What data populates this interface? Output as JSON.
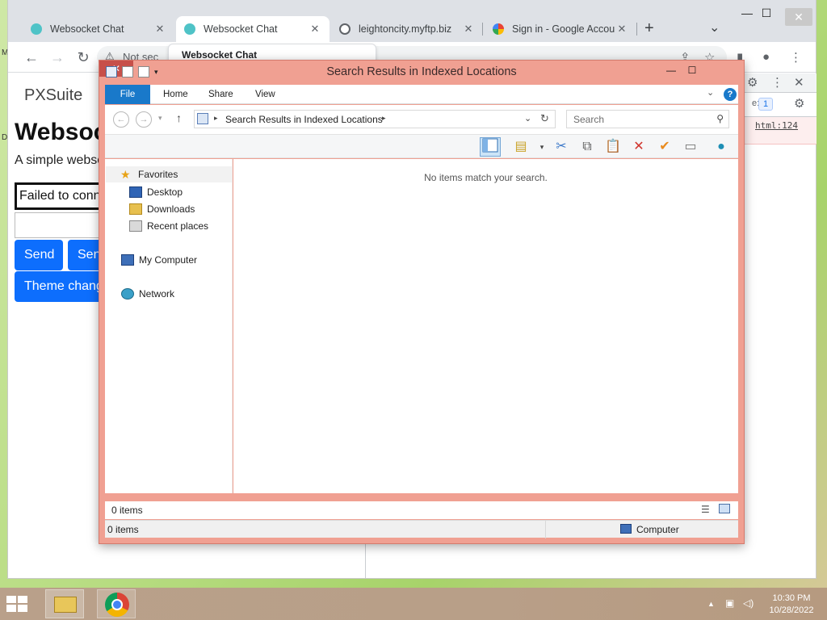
{
  "desktop": {
    "left_label_top": "M",
    "left_label_mid": "D"
  },
  "chrome": {
    "tabs": [
      {
        "title": "Websocket Chat",
        "close": "✕",
        "fav_color": "#4fc3c7",
        "active": false
      },
      {
        "title": "Websocket Chat",
        "close": "✕",
        "fav_color": "#4fc3c7",
        "active": true
      },
      {
        "title": "leightoncity.myftp.biz",
        "close": "✕",
        "fav_color": "#5f6368",
        "active": false
      },
      {
        "title": "Sign in - Google Accou",
        "close": "✕",
        "fav_color": "#4285f4",
        "active": false
      }
    ],
    "new_tab": "+",
    "tab_search": "⌄",
    "window_controls": {
      "minimize": "—",
      "maximize": "☐",
      "close": "✕"
    },
    "nav": {
      "back": "←",
      "forward": "→",
      "reload": "↻"
    },
    "omnibox": {
      "security_icon": "⚠",
      "security_text": "Not sec"
    },
    "tab_hover_title": "Websocket Chat",
    "toolbar_icons": {
      "share": "⇪",
      "star": "☆",
      "side_panel": "▮",
      "profile": "●",
      "menu": "⋮"
    },
    "page": {
      "brand": "PXSuite",
      "heading": "Websoc",
      "subtitle": "A simple webso",
      "status": "Failed to conn",
      "buttons": {
        "send": "Send",
        "send2": "Sen",
        "theme": "Theme chang"
      }
    },
    "devtools": {
      "top_icons": {
        "gear": "⚙",
        "more": "⋮",
        "close": "✕"
      },
      "badge": "1",
      "badge_prefix": "e:",
      "error_link": "html:124"
    }
  },
  "explorer": {
    "title": "Search Results in Indexed Locations",
    "controls": {
      "minimize": "—",
      "maximize": "☐",
      "close": "✕"
    },
    "ribbon_tabs": [
      "File",
      "Home",
      "Share",
      "View"
    ],
    "ribbon_help": "?",
    "address": {
      "back": "←",
      "forward": "→",
      "recent": "▾",
      "up": "↑",
      "path": "Search Results in Indexed Locations",
      "sep": "▸",
      "dropdown": "⌄",
      "refresh": "↻"
    },
    "search_placeholder": "Search",
    "nav_pane": {
      "favorites": "Favorites",
      "items": [
        "Desktop",
        "Downloads",
        "Recent places"
      ],
      "computer": "My Computer",
      "network": "Network"
    },
    "empty_message": "No items match your search.",
    "status_count_top": "0 items",
    "status_count_bottom": "0 items",
    "status_location": "Computer"
  },
  "taskbar": {
    "time": "10:30 PM",
    "date": "10/28/2022",
    "tray": {
      "up": "▲",
      "network": "▣",
      "volume": "◁)"
    }
  }
}
